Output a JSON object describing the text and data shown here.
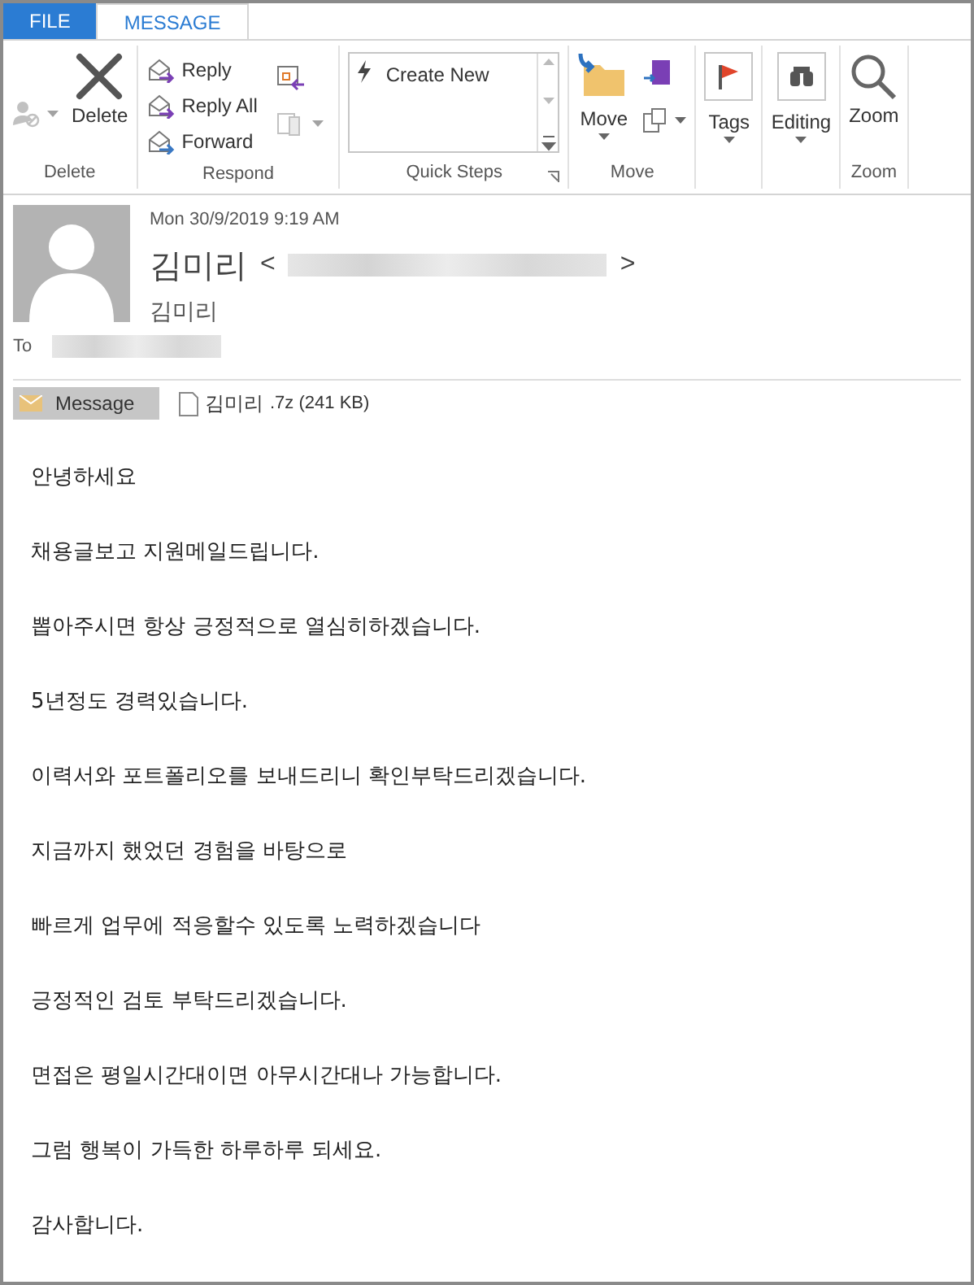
{
  "tabs": [
    {
      "label": "FILE",
      "kind": "file",
      "selected": false
    },
    {
      "label": "MESSAGE",
      "kind": "normal",
      "selected": true
    }
  ],
  "ribbon": {
    "groups": [
      {
        "label": "Delete",
        "buttons": [
          {
            "kind": "ignore"
          },
          {
            "kind": "delete",
            "label": "Delete"
          }
        ]
      },
      {
        "label": "Respond",
        "buttons": [
          {
            "kind": "reply",
            "label": "Reply"
          },
          {
            "kind": "reply-all",
            "label": "Reply All"
          },
          {
            "kind": "forward",
            "label": "Forward"
          }
        ]
      },
      {
        "label": "Quick Steps",
        "buttons": [
          {
            "kind": "quick",
            "label": "Create New"
          }
        ]
      },
      {
        "label": "Move",
        "buttons": [
          {
            "kind": "move",
            "label": "Move"
          }
        ]
      },
      {
        "buttons": [
          {
            "kind": "tags",
            "label": "Tags"
          }
        ]
      },
      {
        "buttons": [
          {
            "kind": "editing",
            "label": "Editing"
          }
        ]
      },
      {
        "label": "Zoom",
        "buttons": [
          {
            "kind": "zoom",
            "label": "Zoom"
          }
        ]
      }
    ]
  },
  "header": {
    "date": "Mon 30/9/2019 9:19 AM",
    "sender": "김미리",
    "open_bracket": "<",
    "close_bracket": ">",
    "sender_display": "김미리",
    "to_label": "To"
  },
  "attachments": [
    {
      "kind": "message",
      "label": "Message",
      "selected": true
    },
    {
      "kind": "file",
      "name": "김미리",
      "ext": ".7z",
      "size": "(241 KB)",
      "selected": false
    }
  ],
  "body": [
    "안녕하세요",
    "채용글보고 지원메일드립니다.",
    "뽑아주시면 항상 긍정적으로 열심히하겠습니다.",
    "5년정도 경력있습니다.",
    "이력서와 포트폴리오를 보내드리니 확인부탁드리겠습니다.",
    "지금까지 했었던 경험을 바탕으로",
    "빠르게 업무에 적응할수 있도록 노력하겠습니다",
    "긍정적인 검토 부탁드리겠습니다.",
    "면접은 평일시간대이면 아무시간대나 가능합니다.",
    "그럼 행복이 가득한 하루하루 되세요.",
    "감사합니다."
  ]
}
